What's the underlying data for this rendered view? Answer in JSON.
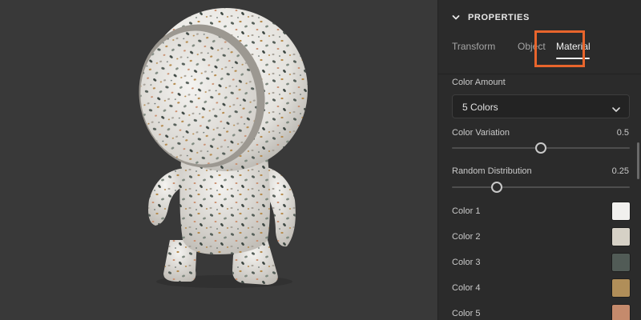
{
  "properties": {
    "header_title": "PROPERTIES",
    "tabs": [
      {
        "label": "Transform"
      },
      {
        "label": "Object"
      },
      {
        "label": "Material"
      }
    ],
    "active_tab": "Material"
  },
  "material": {
    "color_amount": {
      "label": "Color Amount",
      "selected": "5 Colors"
    },
    "color_variation": {
      "label": "Color Variation",
      "value": "0.5",
      "level": 0.5
    },
    "random_distribution": {
      "label": "Random Distribution",
      "value": "0.25",
      "level": 0.25
    },
    "colors": [
      {
        "label": "Color 1",
        "hex": "#f1f0ee"
      },
      {
        "label": "Color 2",
        "hex": "#d6d1c6"
      },
      {
        "label": "Color 3",
        "hex": "#515b56"
      },
      {
        "label": "Color 4",
        "hex": "#b08e59"
      },
      {
        "label": "Color 5",
        "hex": "#c58a6c"
      }
    ]
  },
  "theme": {
    "viewport_bg": "#393939",
    "panel_bg": "#2b2b2b",
    "highlight": "#e8652c"
  }
}
